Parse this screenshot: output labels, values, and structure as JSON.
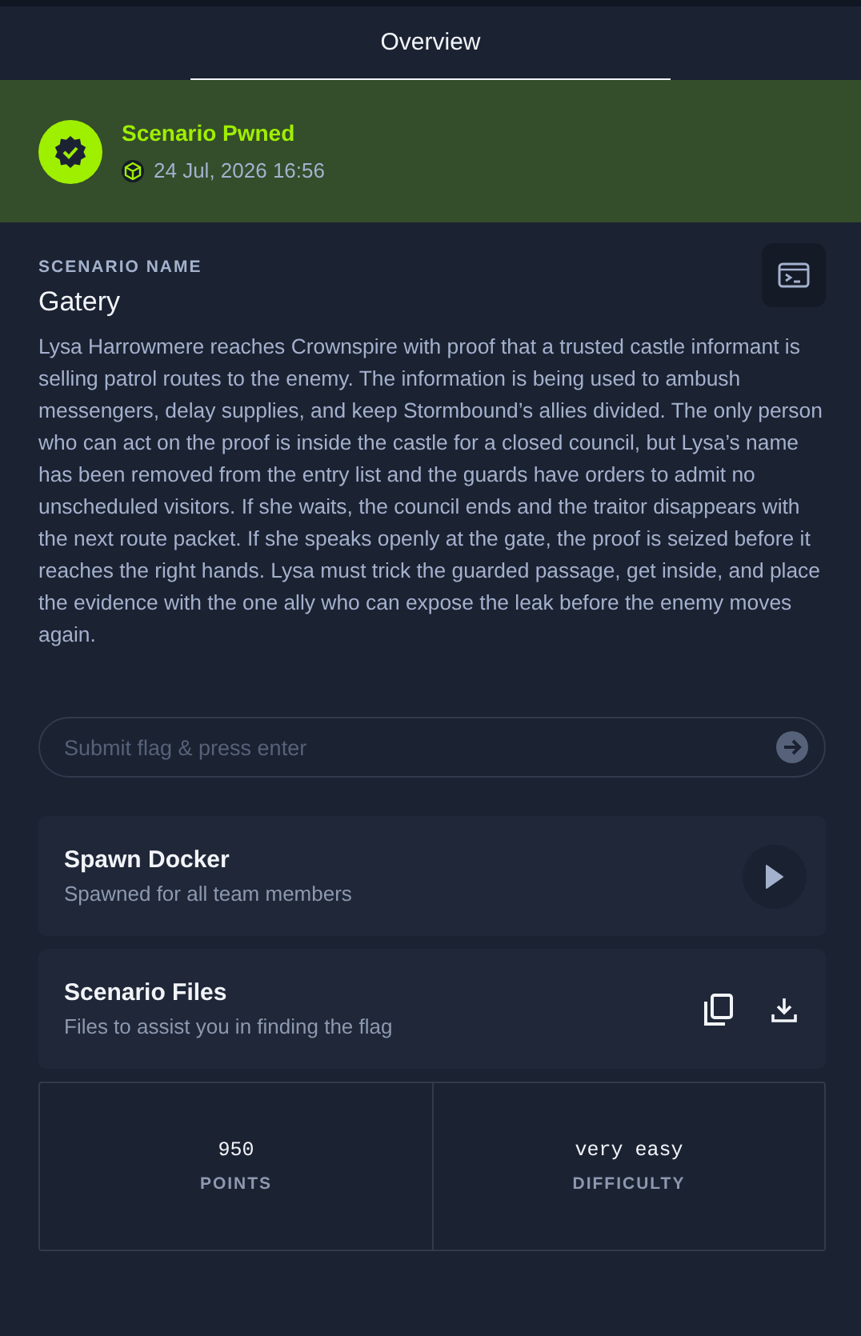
{
  "tabs": [
    {
      "label": "Overview",
      "selected": true
    }
  ],
  "status": {
    "title": "Scenario Pwned",
    "date": "24 Jul, 2026 16:56"
  },
  "scenario": {
    "caption": "SCENARIO NAME",
    "name": "Gatery",
    "description": "Lysa Harrowmere reaches Crownspire with proof that a trusted castle informant is selling patrol routes to the enemy. The information is being used to ambush messengers, delay supplies, and keep Stormbound’s allies divided. The only person who can act on the proof is inside the castle for a closed council, but Lysa’s name has been removed from the entry list and the guards have orders to admit no unscheduled visitors. If she waits, the council ends and the traitor disappears with the next route packet. If she speaks openly at the gate, the proof is seized before it reaches the right hands. Lysa must trick the guarded passage, get inside, and place the evidence with the one ally who can expose the leak before the enemy moves again."
  },
  "flag_field": {
    "placeholder": "Submit flag & press enter"
  },
  "cards": [
    {
      "kind": "docker",
      "title": "Spawn Docker",
      "subtitle": "Spawned for all team members"
    },
    {
      "kind": "files",
      "title": "Scenario Files",
      "subtitle": "Files to assist you in finding the flag"
    }
  ],
  "stats": [
    {
      "value": "950",
      "label": "POINTS"
    },
    {
      "value": "very easy",
      "label": "DIFFICULTY"
    }
  ]
}
